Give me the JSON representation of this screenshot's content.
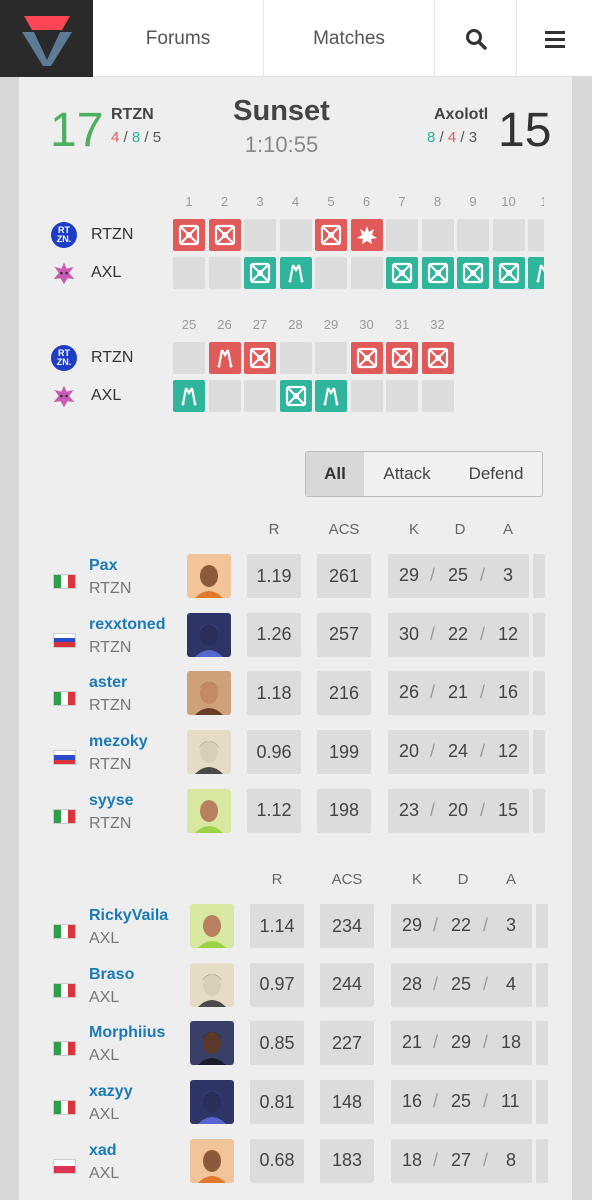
{
  "nav": {
    "logo_icon": "vlr-logo-icon",
    "forums": "Forums",
    "matches": "Matches",
    "search_icon": "search-icon",
    "menu_icon": "hamburger-menu-icon"
  },
  "match": {
    "map": "Sunset",
    "duration": "1:10:55",
    "team1": {
      "score": "17",
      "name": "RTZN",
      "ct": "4",
      "t": "8",
      "ot": "5"
    },
    "team2": {
      "score": "15",
      "name": "Axolotl",
      "ct": "8",
      "t": "4",
      "ot": "3"
    },
    "sep": "/"
  },
  "rounds": {
    "team1_short": "RTZN",
    "team2_short": "AXL",
    "team1_logo_text": [
      "RT",
      "ZN."
    ],
    "block1": {
      "numbers": [
        "1",
        "2",
        "3",
        "4",
        "5",
        "6",
        "7",
        "8",
        "9",
        "10",
        "1"
      ],
      "team1": [
        "elim",
        "elim",
        "",
        "",
        "elim",
        "boom",
        "",
        "",
        "",
        "",
        ""
      ],
      "team2": [
        "",
        "",
        "elim",
        "defuse",
        "",
        "",
        "elim",
        "elim",
        "elim",
        "elim",
        "defuse"
      ]
    },
    "block2": {
      "numbers": [
        "25",
        "26",
        "27",
        "28",
        "29",
        "30",
        "31",
        "32"
      ],
      "team1": [
        "",
        "defuse",
        "elim",
        "",
        "",
        "elim",
        "elim",
        "elim"
      ],
      "team2": [
        "defuse",
        "",
        "",
        "elim",
        "defuse",
        "",
        "",
        ""
      ]
    },
    "colors": {
      "team1": "#e05a5a",
      "team2": "#2fb59c"
    }
  },
  "filter": {
    "all": "All",
    "attack": "Attack",
    "defend": "Defend"
  },
  "stats_headers": {
    "r": "R",
    "acs": "ACS",
    "k": "K",
    "d": "D",
    "a": "A"
  },
  "team1_players": [
    {
      "name": "Pax",
      "team": "RTZN",
      "flag": "it",
      "agent": "raze",
      "r": "1.19",
      "acs": "261",
      "k": "29",
      "d": "25",
      "a": "3"
    },
    {
      "name": "rexxtoned",
      "team": "RTZN",
      "flag": "ru",
      "agent": "omen",
      "r": "1.26",
      "acs": "257",
      "k": "30",
      "d": "22",
      "a": "12"
    },
    {
      "name": "aster",
      "team": "RTZN",
      "flag": "it",
      "agent": "sova",
      "r": "1.18",
      "acs": "216",
      "k": "26",
      "d": "21",
      "a": "16"
    },
    {
      "name": "mezoky",
      "team": "RTZN",
      "flag": "ru",
      "agent": "cypher",
      "r": "0.96",
      "acs": "199",
      "k": "20",
      "d": "24",
      "a": "12"
    },
    {
      "name": "syyse",
      "team": "RTZN",
      "flag": "it",
      "agent": "killjoy",
      "r": "1.12",
      "acs": "198",
      "k": "23",
      "d": "20",
      "a": "15"
    }
  ],
  "team2_players": [
    {
      "name": "RickyVaila",
      "team": "AXL",
      "flag": "it",
      "agent": "killjoy",
      "r": "1.14",
      "acs": "234",
      "k": "29",
      "d": "22",
      "a": "3"
    },
    {
      "name": "Braso",
      "team": "AXL",
      "flag": "it",
      "agent": "cypher",
      "r": "0.97",
      "acs": "244",
      "k": "28",
      "d": "25",
      "a": "4"
    },
    {
      "name": "Morphiius",
      "team": "AXL",
      "flag": "it",
      "agent": "neon",
      "r": "0.85",
      "acs": "227",
      "k": "21",
      "d": "29",
      "a": "18"
    },
    {
      "name": "xazyy",
      "team": "AXL",
      "flag": "it",
      "agent": "omen",
      "r": "0.81",
      "acs": "148",
      "k": "16",
      "d": "25",
      "a": "11"
    },
    {
      "name": "xad",
      "team": "AXL",
      "flag": "pl",
      "agent": "raze",
      "r": "0.68",
      "acs": "183",
      "k": "18",
      "d": "27",
      "a": "8"
    }
  ]
}
